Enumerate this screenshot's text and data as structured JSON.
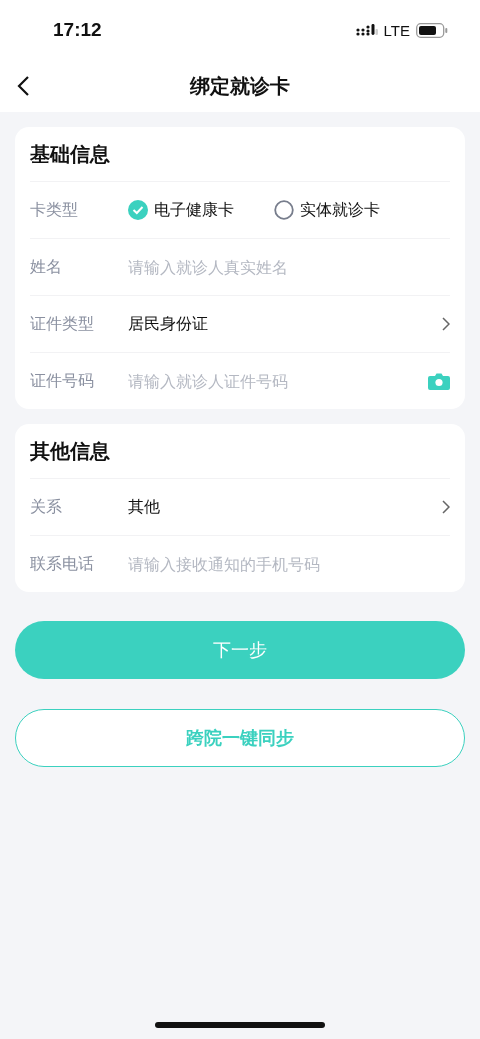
{
  "status_bar": {
    "time": "17:12",
    "network": "LTE"
  },
  "nav": {
    "title": "绑定就诊卡"
  },
  "sections": [
    {
      "title": "基础信息",
      "rows": [
        {
          "kind": "radio",
          "label": "卡类型",
          "options": [
            {
              "label": "电子健康卡",
              "selected": true
            },
            {
              "label": "实体就诊卡",
              "selected": false
            }
          ]
        },
        {
          "kind": "input",
          "label": "姓名",
          "placeholder": "请输入就诊人真实姓名"
        },
        {
          "kind": "select",
          "label": "证件类型",
          "value": "居民身份证"
        },
        {
          "kind": "scan",
          "label": "证件号码",
          "placeholder": "请输入就诊人证件号码"
        }
      ]
    },
    {
      "title": "其他信息",
      "rows": [
        {
          "kind": "select",
          "label": "关系",
          "value": "其他"
        },
        {
          "kind": "input",
          "label": "联系电话",
          "placeholder": "请输入接收通知的手机号码"
        }
      ]
    }
  ],
  "buttons": [
    {
      "kind": "primary",
      "label": "下一步"
    },
    {
      "kind": "outline",
      "label": "跨院一键同步"
    }
  ]
}
